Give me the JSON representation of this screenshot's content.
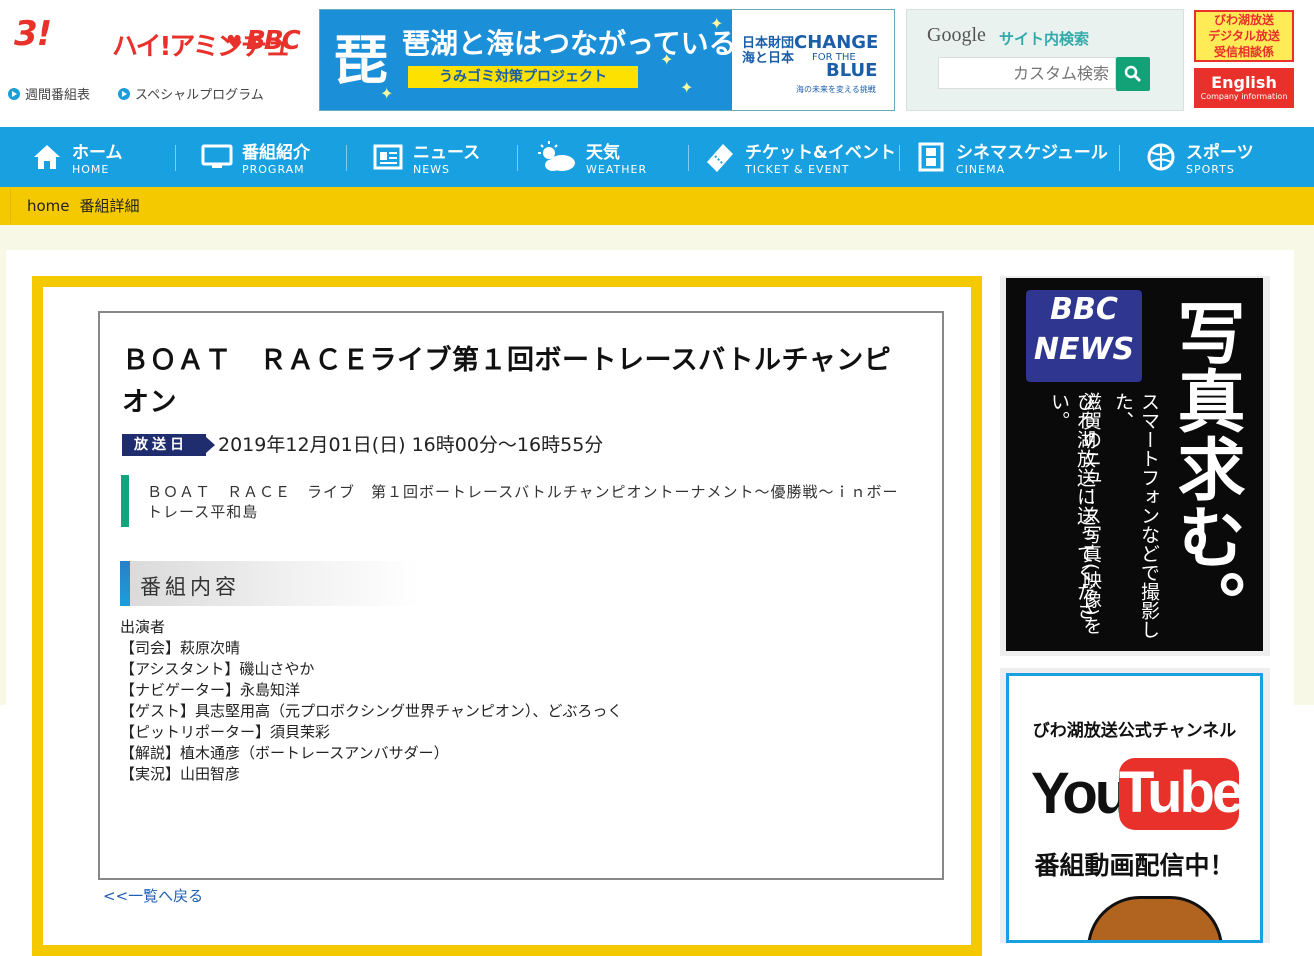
{
  "header": {
    "logo_text_1": "3!",
    "logo_text_2": "ハイ!アミンチュ",
    "logo_text_3": "BBC",
    "links": [
      {
        "label": "週間番組表"
      },
      {
        "label": "スペシャルプログラム"
      }
    ],
    "banner": {
      "kanji": "琵",
      "headline": "琶湖と海はつながっている!",
      "subline": "うみゴミ対策プロジェクト",
      "partner_left": "日本財団\n海と日本",
      "partner_change": "CHANGE",
      "partner_for": "FOR THE",
      "partner_blue": "BLUE",
      "partner_tag": "海の未来を変える挑戦"
    },
    "search": {
      "google_label": "Google",
      "site_label": "サイト内検索",
      "placeholder": "カスタム検索"
    },
    "digital_label": "びわ湖放送\nデジタル放送\n受信相談係",
    "english_label": "English",
    "english_sub": "Company information"
  },
  "nav": {
    "items": [
      {
        "jp": "ホーム",
        "en": "HOME",
        "icon": "home-icon"
      },
      {
        "jp": "番組紹介",
        "en": "PROGRAM",
        "icon": "tv-icon"
      },
      {
        "jp": "ニュース",
        "en": "NEWS",
        "icon": "news-icon"
      },
      {
        "jp": "天気",
        "en": "WEATHER",
        "icon": "weather-icon"
      },
      {
        "jp": "チケット&イベント",
        "en": "TICKET & EVENT",
        "icon": "ticket-icon"
      },
      {
        "jp": "シネマスケジュール",
        "en": "CINEMA",
        "icon": "film-icon"
      },
      {
        "jp": "スポーツ",
        "en": "SPORTS",
        "icon": "ball-icon"
      }
    ]
  },
  "breadcrumb": [
    "home",
    "番組詳細"
  ],
  "program": {
    "title": "ＢＯＡＴ　ＲＡＣＥライブ第１回ボートレースバトルチャンピオン",
    "badge": "放送日",
    "airdate": "2019年12月01日(日) 16時00分～16時55分",
    "subtitle": "ＢＯＡＴ　ＲＡＣＥ　ライブ　第１回ボートレースバトルチャンピオントーナメント～優勝戦～ｉｎボートレース平和島",
    "section_label": "番組内容",
    "body_lines": [
      "出演者",
      "【司会】萩原次晴",
      "【アシスタント】磯山さやか",
      "【ナビゲーター】永島知洋",
      "【ゲスト】具志堅用高（元プロボクシング世界チャンピオン）、どぶろっく",
      "【ピットリポーター】須貝茉彩",
      "【解説】植木通彦（ボートレースアンバサダー）",
      "【実況】山田智彦"
    ],
    "back_link": "<<一覧へ戻る"
  },
  "sidebar": {
    "news_logo": "BBC NEWS",
    "news_big": "写真求む。",
    "news_lines": [
      "スマートフォンなどで撮影した、",
      "滋賀のニュース写真(映像)を",
      "びわ湖放送に送ってください。"
    ],
    "yt_channel": "びわ湖放送公式チャンネル",
    "yt_you": "You",
    "yt_tube": "Tube",
    "yt_msg": "番組動画配信中！"
  },
  "colors": {
    "nav_blue": "#18a0e0",
    "accent_yellow": "#f4c900",
    "badge_navy": "#1f2d6e",
    "subtitle_green": "#15a37e",
    "youtube_red": "#e8312a"
  }
}
